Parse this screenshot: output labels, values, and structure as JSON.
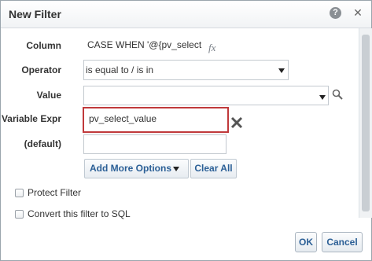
{
  "dialog": {
    "title": "New Filter",
    "help_symbol": "?",
    "close_symbol": "✕"
  },
  "fields": {
    "column_label": "Column",
    "column_value": "CASE WHEN '@{pv_select",
    "fx_symbol": "fx",
    "operator_label": "Operator",
    "operator_value": "is equal to / is in",
    "value_label": "Value",
    "value_value": "",
    "variable_expr_label": "Variable Expr",
    "variable_expr_value": "pv_select_value",
    "default_label": "(default)",
    "default_value": ""
  },
  "buttons": {
    "add_more_options": "Add More Options",
    "clear_all": "Clear All",
    "ok": "OK",
    "cancel": "Cancel"
  },
  "checkboxes": {
    "protect_filter": "Protect Filter",
    "convert_to_sql": "Convert this filter to SQL"
  },
  "colors": {
    "highlight": "#c0393b",
    "button_text": "#2b5f96"
  }
}
